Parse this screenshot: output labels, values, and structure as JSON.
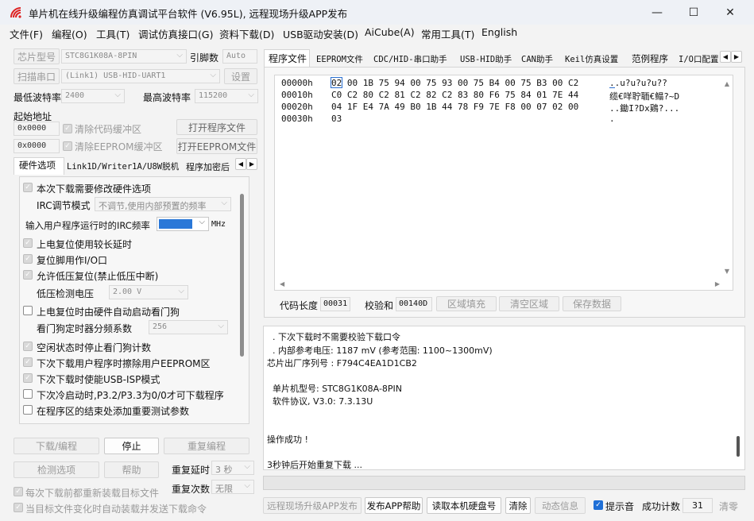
{
  "window": {
    "title": "单片机在线升级编程仿真调试平台软件 (V6.95L), 远程现场升级APP发布",
    "min": "—",
    "max": "☐",
    "close": "✕"
  },
  "menu": [
    "文件(F)",
    "编程(O)",
    "工具(T)",
    "调试仿真接口(G)",
    "资料下载(D)",
    "USB驱动安装(D)",
    "AiCube(A)",
    "常用工具(T)",
    "English"
  ],
  "left": {
    "chip_btn": "芯片型号",
    "chip_value": "STC8G1K08A-8PIN",
    "pin_label": "引脚数",
    "pin_value": "Auto",
    "scan_btn": "扫描串口",
    "port_value": "(Link1) USB-HID-UART1",
    "settings_btn": "设置",
    "min_baud_label": "最低波特率",
    "min_baud": "2400",
    "max_baud_label": "最高波特率",
    "max_baud": "115200",
    "start_addr_label": "起始地址",
    "addr1": "0x0000",
    "clear_code": "清除代码缓冲区",
    "open_prog": "打开程序文件",
    "addr2": "0x0000",
    "clear_eeprom": "清除EEPROM缓冲区",
    "open_eeprom": "打开EEPROM文件",
    "tabs": [
      "硬件选项",
      "Link1D/Writer1A/U8W脱机",
      "程序加密后"
    ],
    "hw": {
      "opt1": "本次下载需要修改硬件选项",
      "irc_mode_label": "IRC调节模式",
      "irc_mode_value": "不调节,使用内部预置的频率",
      "irc_freq_label": "输入用户程序运行时的IRC频率",
      "irc_freq_unit": "MHz",
      "opt2": "上电复位使用较长延时",
      "opt3": "复位脚用作I/O口",
      "opt4": "允许低压复位(禁止低压中断)",
      "lvd_label": "低压检测电压",
      "lvd_value": "2.00 V",
      "opt5": "上电复位时由硬件自动启动看门狗",
      "wdt_label": "看门狗定时器分频系数",
      "wdt_value": "256",
      "opt6": "空闲状态时停止看门狗计数",
      "opt7": "下次下载用户程序时擦除用户EEPROM区",
      "opt8": "下次下载时使能USB-ISP模式",
      "opt9": "下次冷启动时,P3.2/P3.3为0/0才可下载程序",
      "opt10": "在程序区的结束处添加重要测试参数"
    },
    "download_btn": "下载/编程",
    "stop_btn": "停止",
    "redownload_btn": "重复编程",
    "detect_btn": "检测选项",
    "help_btn": "帮助",
    "repeat_delay_label": "重复延时",
    "repeat_delay": "3 秒",
    "repeat_count_label": "重复次数",
    "repeat_count": "无限",
    "reload_chk": "每次下载前都重新装载目标文件",
    "auto_chk": "当目标文件变化时自动装载并发送下载命令"
  },
  "right": {
    "tabs": [
      "程序文件",
      "EEPROM文件",
      "CDC/HID-串口助手",
      "USB-HID助手",
      "CAN助手",
      "Keil仿真设置",
      "范例程序",
      "I/O口配置"
    ],
    "hex_rows": [
      {
        "addr": "00000h",
        "bytes": "02 00 1B 75 94 00 75 93 00 75 B4 00 75 B3 00 C2",
        "ascii": "..u?u?u?u??"
      },
      {
        "addr": "00010h",
        "bytes": "C0 C2 80 C2 81 C2 82 C2 83 80 F6 75 84 01 7E 44",
        "ascii": "缆€咩聍聏€鳎?~D"
      },
      {
        "addr": "00020h",
        "bytes": "04 1F E4 7A 49 B0 1B 44 78 F9 7E F8 00 07 02 00",
        "ascii": "..鋤I?Dx鶏?..."
      },
      {
        "addr": "00030h",
        "bytes": "03",
        "ascii": "."
      }
    ],
    "code_len_label": "代码长度",
    "code_len": "00031",
    "checksum_label": "校验和",
    "checksum": "00140D",
    "fill_btn": "区域填充",
    "clear_area_btn": "清空区域",
    "save_btn": "保存数据",
    "log": [
      "  . 下次下载时不需要校验下载口令",
      "  . 内部参考电压: 1187 mV (参考范围: 1100~1300mV)",
      "芯片出厂序列号 : F794C4EA1D1CB2",
      "",
      "  单片机型号: STC8G1K08A-8PIN",
      "  软件协议, V3.0: 7.3.13U",
      "",
      "",
      "操作成功 !",
      "",
      "3秒钟后开始重复下载 ..."
    ],
    "remote_btn": "远程现场升级APP发布",
    "publish_help_btn": "发布APP帮助",
    "read_disk_btn": "读取本机硬盘号",
    "clear_btn": "清除",
    "anim_btn": "动态信息",
    "beep_label": "提示音",
    "success_label": "成功计数",
    "success_count": "31",
    "reset_btn": "清零"
  }
}
